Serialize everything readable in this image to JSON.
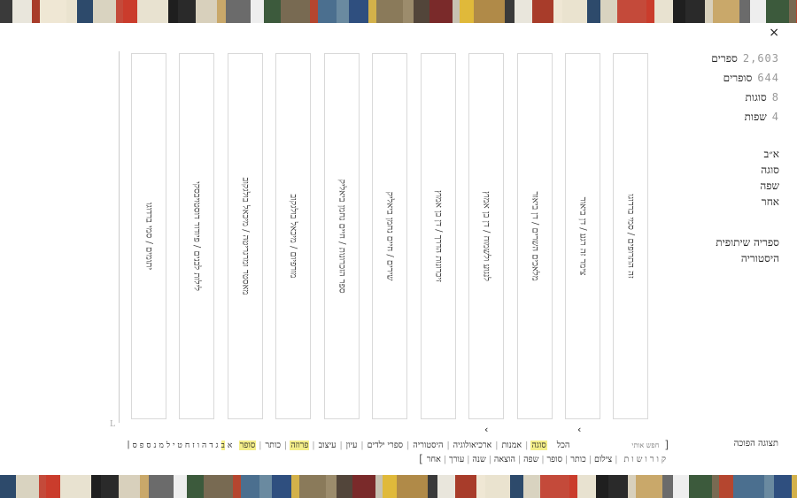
{
  "close_label": "×",
  "stats": [
    {
      "num": "2,603",
      "label": "ספרים"
    },
    {
      "num": "644",
      "label": "סופרים"
    },
    {
      "num": "8",
      "label": "סוגות"
    },
    {
      "num": "4",
      "label": "שפות"
    }
  ],
  "sort_menu": [
    "א״ב",
    "סוגה",
    "שפה",
    "אחר"
  ],
  "links": [
    "ספריה שיתופית",
    "היסטוריה"
  ],
  "books": [
    "זה התרופים / סמי ברדוגו",
    "צימר זה רגע / דן ביאור",
    "מלאכים השרים / דן ביאור",
    "לנגוע ולשמוח / דן בן אמוץ",
    "זיכרונות הדרך / דן בן אמוץ",
    "שירים / חיים נחמן ביאליק",
    "ספר הזכרונות / חיים נחמן ביאליק",
    "מורפיום / מיכאל בולגקוב",
    "מאסטר ומרגריטה / מיכאל בולגקוב",
    "לילות לבנים / פיודור דוסטויבסקי",
    "יתומים / סמי ברדוגו"
  ],
  "nav": {
    "prev": "‹",
    "next": "‹"
  },
  "upside_down": "תצוגה הפוכה",
  "search_placeholder": "חפש אותי",
  "filters": [
    {
      "label": "הכל",
      "hl": false
    },
    {
      "label": "סוגה",
      "hl": true
    },
    {
      "label": "אמנות",
      "hl": false
    },
    {
      "label": "ארכיאולוגיה",
      "hl": false
    },
    {
      "label": "היסטוריה",
      "hl": false
    },
    {
      "label": "ספרי ילדים",
      "hl": false
    },
    {
      "label": "עיון",
      "hl": false
    },
    {
      "label": "עיצוב",
      "hl": false
    },
    {
      "label": "פרוזה",
      "hl": true
    },
    {
      "label": "כותר",
      "hl": false
    },
    {
      "label": "סופר",
      "hl": true
    }
  ],
  "letters": [
    {
      "c": "א",
      "hl": false
    },
    {
      "c": "ב",
      "hl": true
    },
    {
      "c": "ג",
      "hl": false
    },
    {
      "c": "ד",
      "hl": false
    },
    {
      "c": "ה",
      "hl": false
    },
    {
      "c": "ו",
      "hl": false
    },
    {
      "c": "ז",
      "hl": false
    },
    {
      "c": "ח",
      "hl": false
    },
    {
      "c": "ט",
      "hl": false
    },
    {
      "c": "י",
      "hl": false
    },
    {
      "c": "ל",
      "hl": false
    },
    {
      "c": "מ",
      "hl": false
    },
    {
      "c": "נ",
      "hl": false
    },
    {
      "c": "ס",
      "hl": false
    },
    {
      "c": "פ",
      "hl": false
    },
    {
      "c": "ס",
      "hl": false
    },
    {
      "c": "|",
      "hl": false
    }
  ],
  "row2_label": "קורושות",
  "row2_items": [
    "צילום",
    "כותר",
    "סופר",
    "שפה",
    "הוצאה",
    "שנה",
    "עורך",
    "אחר"
  ],
  "shelf_colors": [
    "#3a3a3a",
    "#c9a86a",
    "#7a2a2a",
    "#e8e2d0",
    "#d3b14a",
    "#2d4a6b",
    "#b5462f",
    "#e9e6dc",
    "#6b6b6b",
    "#c7c2b2",
    "#1f1f1f",
    "#8a7a5a",
    "#d9d3c0",
    "#4b6f8f",
    "#a83c2a",
    "#eeeeee",
    "#e0b93a",
    "#2a2a2a",
    "#9c8c6c",
    "#c44a3a",
    "#6a8aa0",
    "#efe7d4",
    "#3c5a3c",
    "#b08a48",
    "#d8d0bc",
    "#52453a",
    "#ca3c2c",
    "#2f4f7f",
    "#eae3cf",
    "#786a52"
  ]
}
